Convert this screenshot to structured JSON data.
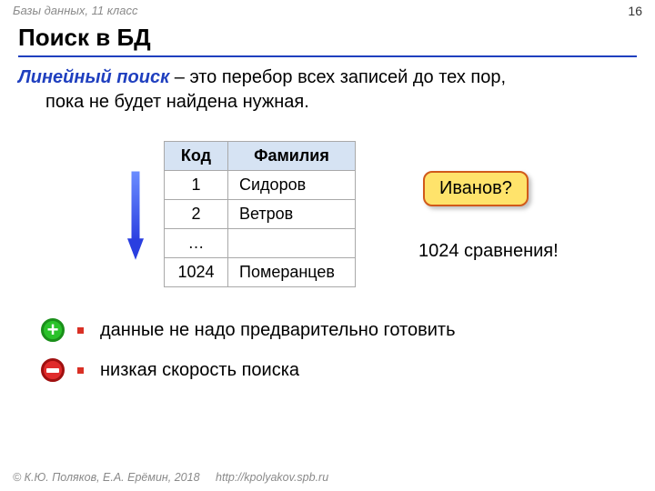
{
  "header": {
    "course": "Базы данных, 11 класс",
    "page": "16"
  },
  "title": "Поиск в БД",
  "definition": {
    "term": "Линейный поиск",
    "rest_line1": " – это перебор всех записей до тех пор,",
    "line2": "пока не будет найдена нужная."
  },
  "table": {
    "headers": {
      "code": "Код",
      "surname": "Фамилия"
    },
    "rows": [
      {
        "code": "1",
        "surname": "Сидоров"
      },
      {
        "code": "2",
        "surname": "Ветров"
      },
      {
        "code": "…",
        "surname": ""
      },
      {
        "code": "1024",
        "surname": "Померанцев"
      }
    ]
  },
  "callout": "Иванов?",
  "comparisons": "1024 сравнения!",
  "bullets": {
    "plus": "данные не надо предварительно готовить",
    "minus": "низкая скорость поиска"
  },
  "footer": {
    "copyright": "© К.Ю. Поляков, Е.А. Ерёмин, 2018",
    "url": "http://kpolyakov.spb.ru"
  }
}
